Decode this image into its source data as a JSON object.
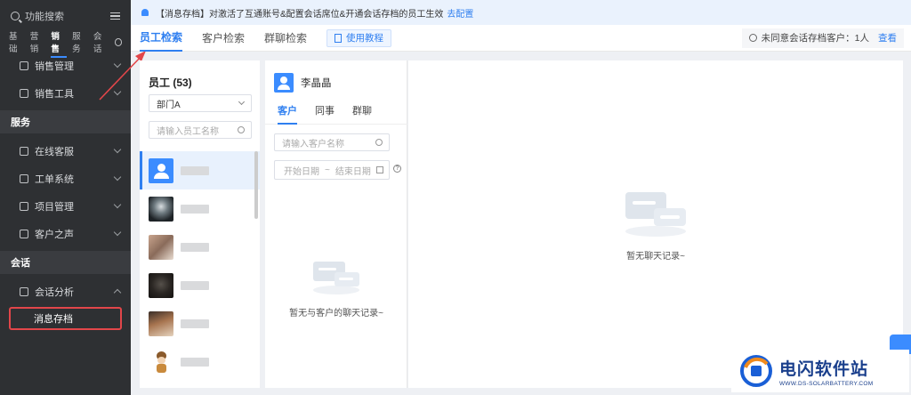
{
  "sidebar": {
    "search_label": "功能搜索",
    "categories": [
      "基础",
      "营销",
      "销售",
      "服务",
      "会话"
    ],
    "active_category": "销售",
    "items_top": [
      {
        "label": "销售管理"
      },
      {
        "label": "销售工具"
      }
    ],
    "group_service": "服务",
    "items_service": [
      {
        "label": "在线客服"
      },
      {
        "label": "工单系统"
      },
      {
        "label": "项目管理"
      },
      {
        "label": "客户之声"
      }
    ],
    "group_chat": "会话",
    "item_analysis": "会话分析",
    "item_archive": "消息存档"
  },
  "notice": {
    "text": "【消息存档】对激活了互通账号&配置会话席位&开通会话存档的员工生效",
    "link": "去配置"
  },
  "tabs": {
    "employee": "员工检索",
    "customer": "客户检索",
    "group": "群聊检索",
    "tutorial": "使用教程",
    "unconsent_label": "未同意会话存档客户：1人",
    "view_link": "查看"
  },
  "employee_panel": {
    "title": "员工 (53)",
    "dept_select": "部门A",
    "search_placeholder": "请输入员工名称"
  },
  "customer_panel": {
    "selected_name": "李晶晶",
    "sub_tabs": [
      "客户",
      "同事",
      "群聊"
    ],
    "search_placeholder": "请输入客户名称",
    "start_date": "开始日期",
    "separator": "~",
    "end_date": "结束日期",
    "empty_text": "暂无与客户的聊天记录~"
  },
  "chat_panel": {
    "empty_text": "暂无聊天记录~"
  },
  "watermark": {
    "title": "电闪软件站",
    "subtitle": "WWW.DS-SOLARBATTERY.COM"
  },
  "colors": {
    "accent": "#2f7ff0",
    "sidebar_bg": "#2e3033",
    "highlight_border": "#e2464a"
  }
}
